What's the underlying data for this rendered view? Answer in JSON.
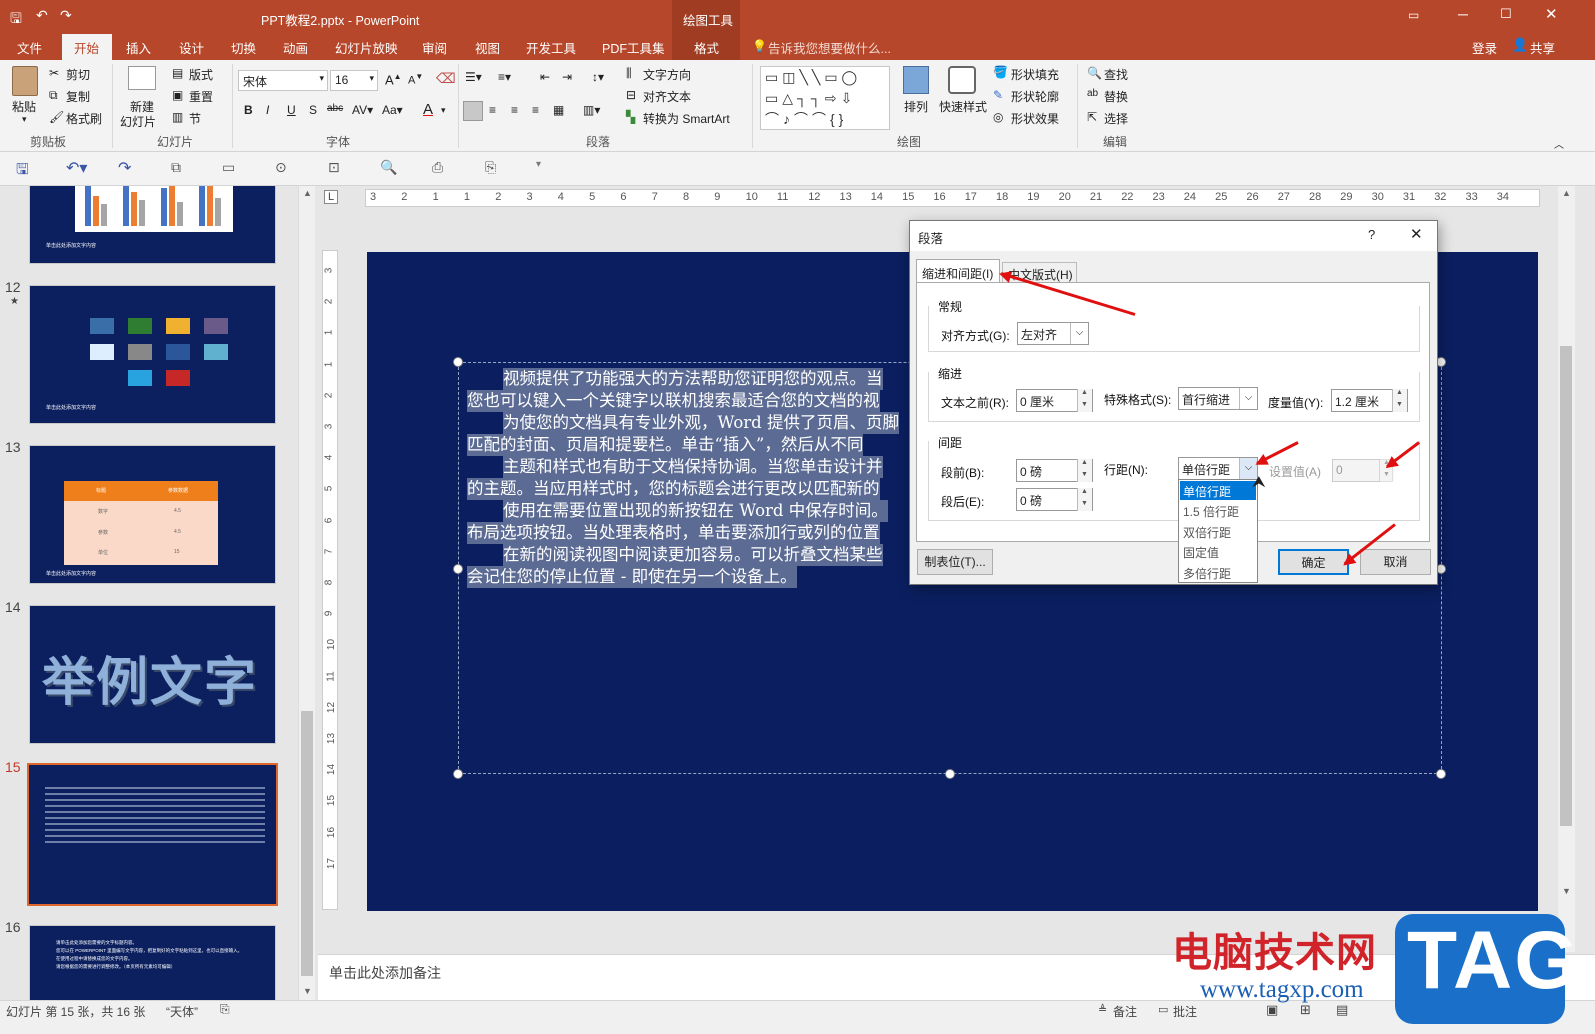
{
  "title_bar": {
    "doc_title": "PPT教程2.pptx - PowerPoint",
    "contextual": "绘图工具"
  },
  "tabs": [
    "文件",
    "开始",
    "插入",
    "设计",
    "切换",
    "动画",
    "幻灯片放映",
    "审阅",
    "视图",
    "开发工具",
    "PDF工具集",
    "格式"
  ],
  "tell_me": "告诉我您想要做什么...",
  "login": "登录",
  "share": "共享",
  "ribbon": {
    "clipboard": {
      "paste": "粘贴",
      "cut": "剪切",
      "copy": "复制",
      "painter": "格式刷",
      "group": "剪贴板"
    },
    "slides": {
      "new_slide_1": "新建",
      "new_slide_2": "幻灯片",
      "layout": "版式",
      "reset": "重置",
      "section": "节",
      "group": "幻灯片"
    },
    "font": {
      "name": "宋体",
      "size": "16",
      "group": "字体"
    },
    "paragraph": {
      "text_dir": "文字方向",
      "align_text": "对齐文本",
      "smartart": "转换为 SmartArt",
      "group": "段落"
    },
    "drawing": {
      "arrange": "排列",
      "quick_styles": "快速样式",
      "fill": "形状填充",
      "outline": "形状轮廓",
      "effects": "形状效果",
      "group": "绘图"
    },
    "editing": {
      "find": "查找",
      "replace": "替换",
      "select": "选择",
      "group": "编辑"
    }
  },
  "ruler_numbers": [
    "3",
    "2",
    "1",
    "1",
    "2",
    "3",
    "4",
    "5",
    "6",
    "7",
    "8",
    "9",
    "10",
    "11",
    "12",
    "13",
    "14",
    "15",
    "16",
    "17",
    "18",
    "19",
    "20",
    "21",
    "22",
    "23",
    "24",
    "25",
    "26",
    "27",
    "28",
    "29",
    "30",
    "31",
    "32",
    "33",
    "34"
  ],
  "vruler_numbers": [
    "3",
    "2",
    "1",
    "1",
    "2",
    "3",
    "4",
    "5",
    "6",
    "7",
    "8",
    "9",
    "10",
    "11",
    "12",
    "13",
    "14",
    "15",
    "16",
    "17"
  ],
  "slides": [
    {
      "num": "12",
      "star": "★",
      "caption": "单击此处添加文字内容"
    },
    {
      "num": "13",
      "caption": "单击此处添加文字内容",
      "table_h1": "标题",
      "table_h2": "参数数据",
      "rows": [
        [
          "数字",
          "4.5"
        ],
        [
          "参数",
          "4.5"
        ],
        [
          "单位",
          "15"
        ]
      ]
    },
    {
      "num": "14",
      "big_text": "举例文字"
    },
    {
      "num": "15"
    },
    {
      "num": "16",
      "bullets": [
        "请单击此处添加您需要的文字标题内容。",
        "您可以在 POWERPOINT 里面编写文字内容，把复制好的文字粘贴到这里，也可以直接输入。",
        "在使用过程中请替换成您的文字内容。",
        "请您根据您的需要进行调整修改。（本页所有元素均可编辑）"
      ]
    }
  ],
  "thumb_top_caption": "单击此处添加文字内容",
  "slide_text": [
    "视频提供了功能强大的方法帮助您证明您的观点。当",
    "您也可以键入一个关键字以联机搜索最适合您的文档的视",
    "为使您的文档具有专业外观，Word 提供了页眉、页脚",
    "匹配的封面、页眉和提要栏。单击“插入”，然后从不同",
    "主题和样式也有助于文档保持协调。当您单击设计并",
    "的主题。当应用样式时，您的标题会进行更改以匹配新的",
    "使用在需要位置出现的新按钮在 Word 中保存时间。",
    "布局选项按钮。当处理表格时，单击要添加行或列的位置",
    "在新的阅读视图中阅读更加容易。可以折叠文档某些",
    "会记住您的停止位置 - 即使在另一个设备上。"
  ],
  "notes_placeholder": "单击此处添加备注",
  "status": {
    "slide_info": "幻灯片 第 15 张，共 16 张",
    "theme": "“天体”",
    "notes": "备注",
    "comments": "批注"
  },
  "dialog": {
    "title": "段落",
    "help": "?",
    "tab1": "缩进和间距(I)",
    "tab2": "中文版式(H)",
    "general": "常规",
    "align_label": "对齐方式(G):",
    "align_value": "左对齐",
    "indent": "缩进",
    "before_text_label": "文本之前(R):",
    "before_text_value": "0 厘米",
    "special_label": "特殊格式(S):",
    "special_value": "首行缩进",
    "by_label": "度量值(Y):",
    "by_value": "1.2 厘米",
    "spacing": "间距",
    "before_label": "段前(B):",
    "before_value": "0 磅",
    "after_label": "段后(E):",
    "after_value": "0 磅",
    "line_label": "行距(N):",
    "line_value": "单倍行距",
    "at_label": "设置值(A)",
    "at_value": "0",
    "options": [
      "单倍行距",
      "1.5 倍行距",
      "双倍行距",
      "固定值",
      "多倍行距"
    ],
    "tabs_btn": "制表位(T)...",
    "ok": "确定",
    "cancel": "取消"
  },
  "watermark": {
    "brand": "电脑技术网",
    "url": "www.tagxp.com",
    "tag": "TAG"
  },
  "colors": {
    "ribbon": "#b7472a",
    "slide_bg": "#0b1f60",
    "selection": "#0078d7",
    "arrow": "#e01010"
  }
}
